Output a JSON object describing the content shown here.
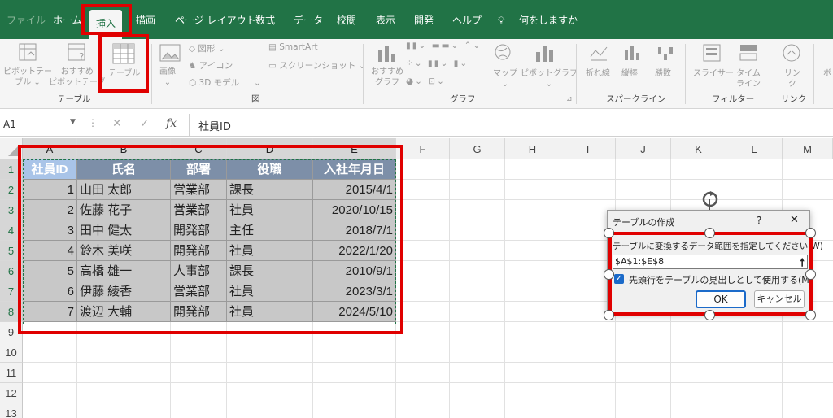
{
  "tabs": {
    "file": "ファイル",
    "home": "ホーム",
    "insert": "挿入",
    "draw": "描画",
    "page_layout": "ページ レイアウト",
    "formulas": "数式",
    "data": "データ",
    "review": "校閲",
    "view": "表示",
    "developer": "開発",
    "help": "ヘルプ",
    "tell_me": "何をしますか"
  },
  "ribbon": {
    "pivot1": "ピボットテー",
    "pivot2": "ブル ⌄",
    "rec_pivot1": "おすすめ",
    "rec_pivot2": "ピボットテーブ",
    "table": "テーブル",
    "image": "画像",
    "image_caret": "⌄",
    "shapes": "図形 ⌄",
    "icons": "アイコン",
    "model3d": "3D モデル",
    "model3d_caret": "⌄",
    "smartart": "SmartArt",
    "screenshot": "スクリーンショット ⌄",
    "rec_chart1": "おすすめ",
    "rec_chart2": "グラフ",
    "maps": "マップ",
    "pivot_chart": "ピボットグラフ",
    "line": "折れ線",
    "column": "縦棒",
    "winloss": "勝敗",
    "slicer": "スライサー",
    "timeline1": "タイム",
    "timeline2": "ライン",
    "link1": "リン",
    "link2": "ク",
    "comment": "ボ",
    "group_tables": "テーブル",
    "group_illustrations": "図",
    "group_charts": "グラフ",
    "group_sparklines": "スパークライン",
    "group_filters": "フィルター",
    "group_links": "リンク"
  },
  "formula_bar": {
    "name_box": "A1",
    "fx": "fx",
    "content": "社員ID"
  },
  "columns": [
    "A",
    "B",
    "C",
    "D",
    "E",
    "F",
    "G",
    "H",
    "I",
    "J",
    "K",
    "L",
    "M"
  ],
  "rows": [
    "1",
    "2",
    "3",
    "4",
    "5",
    "6",
    "7",
    "8",
    "9",
    "10",
    "11",
    "12",
    "13"
  ],
  "table": {
    "headers": [
      "社員ID",
      "氏名",
      "部署",
      "役職",
      "入社年月日"
    ],
    "data": [
      [
        "1",
        "山田 太郎",
        "営業部",
        "課長",
        "2015/4/1"
      ],
      [
        "2",
        "佐藤 花子",
        "営業部",
        "社員",
        "2020/10/15"
      ],
      [
        "3",
        "田中 健太",
        "開発部",
        "主任",
        "2018/7/1"
      ],
      [
        "4",
        "鈴木 美咲",
        "開発部",
        "社員",
        "2022/1/20"
      ],
      [
        "5",
        "高橋 雄一",
        "人事部",
        "課長",
        "2010/9/1"
      ],
      [
        "6",
        "伊藤 綾香",
        "営業部",
        "社員",
        "2023/3/1"
      ],
      [
        "7",
        "渡辺 大輔",
        "開発部",
        "社員",
        "2024/5/10"
      ]
    ]
  },
  "dialog": {
    "title": "テーブルの作成",
    "help": "?",
    "close": "✕",
    "prompt": "テーブルに変換するデータ範囲を指定してください(W)",
    "range": "$A$1:$E$8",
    "checkbox_label": "先頭行をテーブルの見出しとして使用する(M)",
    "checkbox_checked": true,
    "ok": "OK",
    "cancel": "キャンセル"
  },
  "colors": {
    "excel_green": "#217346",
    "highlight_red": "#e00000",
    "table_header": "#7d8fa8",
    "selection_gray": "#c8c8c8"
  }
}
